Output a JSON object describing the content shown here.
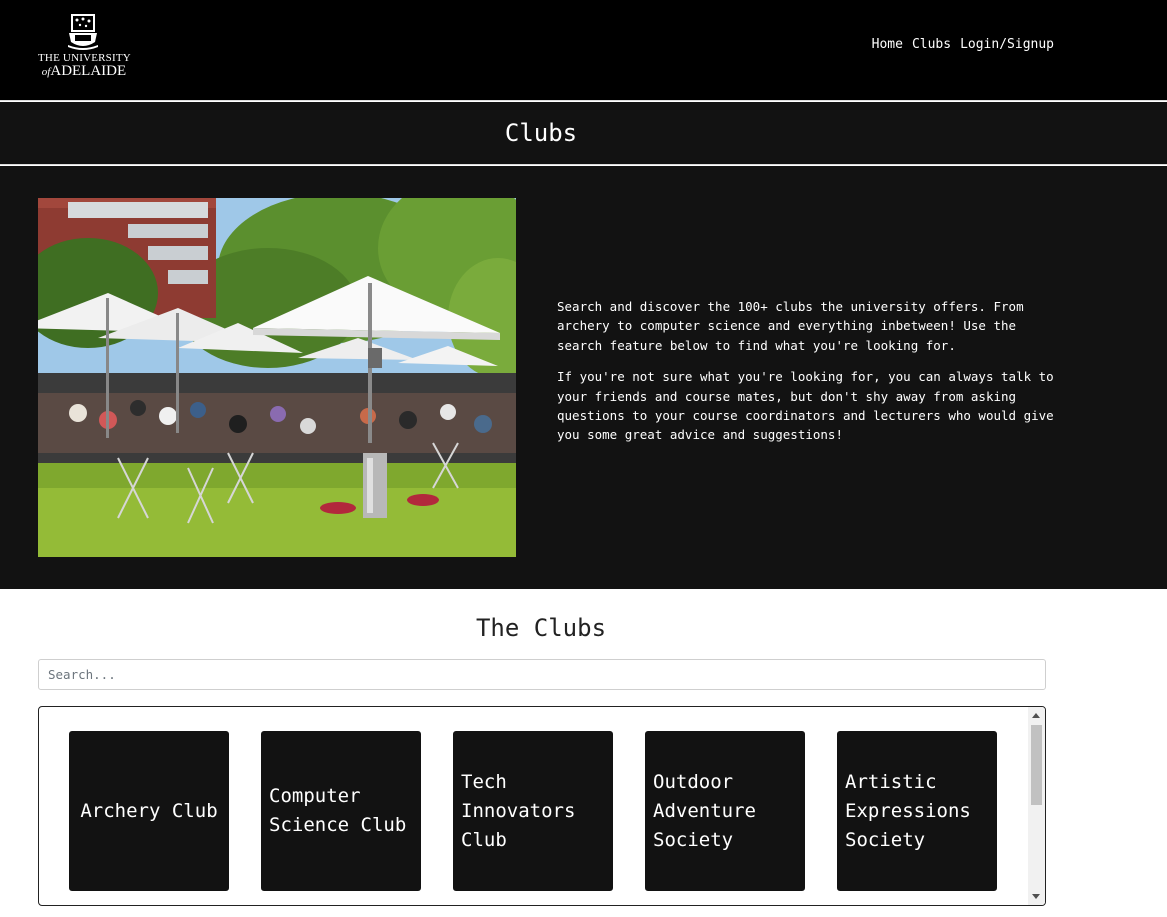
{
  "header": {
    "logo": {
      "line1": "THE UNIVERSITY",
      "line2_prefix": "of",
      "line2": "ADELAIDE",
      "icon": "university-crest-icon"
    },
    "nav": [
      {
        "label": "Home"
      },
      {
        "label": "Clubs"
      },
      {
        "label": "Login/Signup"
      }
    ]
  },
  "page": {
    "title": "Clubs"
  },
  "hero": {
    "image": "outdoor-cafe-umbrellas-photo",
    "paragraphs": [
      "Search and discover the 100+ clubs the university offers. From archery to computer science and everything inbetween! Use the search feature below to find what you're looking for.",
      "If you're not sure what you're looking for, you can always talk to your friends and course mates, but don't shy away from asking questions to your course coordinators and lecturers who would give you some great advice and suggestions!"
    ]
  },
  "clubs_section": {
    "title": "The Clubs",
    "search": {
      "placeholder": "Search...",
      "value": ""
    },
    "clubs": [
      {
        "name": "Archery Club"
      },
      {
        "name": "Computer Science Club"
      },
      {
        "name": "Tech Innovators Club"
      },
      {
        "name": "Outdoor Adventure Society"
      },
      {
        "name": "Artistic Expressions Society"
      }
    ]
  },
  "colors": {
    "header_bg": "#000000",
    "band_bg": "#121212",
    "card_bg": "#121212",
    "text_light": "#ffffff"
  }
}
